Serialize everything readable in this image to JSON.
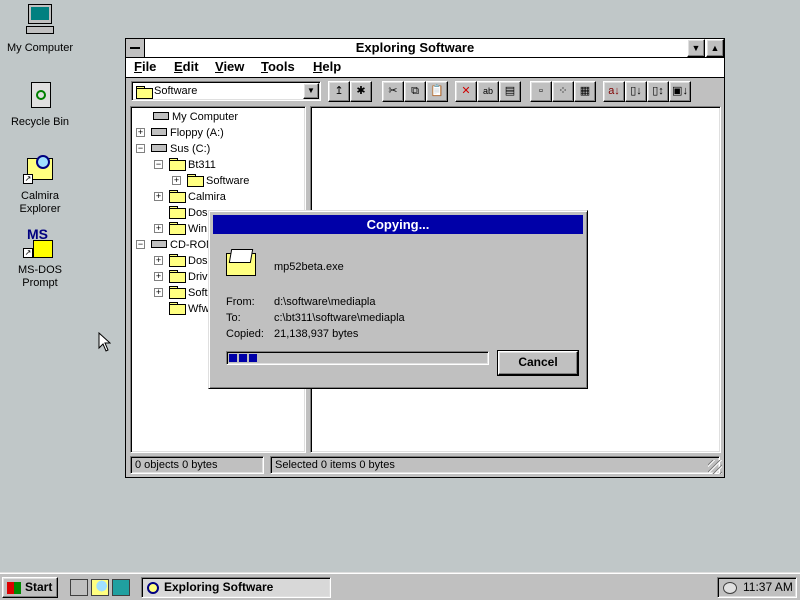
{
  "desktop": {
    "icons": [
      {
        "label": "My Computer",
        "icon": "computer-icon"
      },
      {
        "label": "Recycle Bin",
        "icon": "recycle-bin-icon"
      },
      {
        "label": "Calmira Explorer",
        "icon": "magnifier-icon"
      },
      {
        "label": "MS-DOS Prompt",
        "icon": "msdos-icon"
      }
    ]
  },
  "explorer": {
    "title": "Exploring Software",
    "menu": [
      "File",
      "Edit",
      "View",
      "Tools",
      "Help"
    ],
    "location": "Software",
    "tree": [
      {
        "label": "My Computer",
        "type": "computer"
      },
      {
        "label": "Floppy (A:)",
        "type": "drive"
      },
      {
        "label": "Sus (C:)",
        "type": "drive"
      },
      {
        "label": "Bt311",
        "type": "folder"
      },
      {
        "label": "Software",
        "type": "folder-open"
      },
      {
        "label": "Calmira",
        "type": "folder"
      },
      {
        "label": "Dos",
        "type": "folder"
      },
      {
        "label": "Win",
        "type": "folder"
      },
      {
        "label": "CD-ROM",
        "type": "cdrom"
      },
      {
        "label": "Dos",
        "type": "folder"
      },
      {
        "label": "Drive",
        "type": "folder"
      },
      {
        "label": "Soft",
        "type": "folder"
      },
      {
        "label": "Wfw",
        "type": "folder"
      }
    ],
    "status_left": "0 objects  0 bytes",
    "status_right": "Selected 0 items  0 bytes"
  },
  "dialog": {
    "title": "Copying...",
    "filename": "mp52beta.exe",
    "from_label": "From:",
    "from_value": "d:\\software\\mediapla",
    "to_label": "To:",
    "to_value": "c:\\bt311\\software\\mediapla",
    "copied_label": "Copied:",
    "copied_value": "21,138,937 bytes",
    "progress_percent": 12,
    "cancel_label": "Cancel"
  },
  "taskbar": {
    "start_label": "Start",
    "task_label": "Exploring Software",
    "clock": "11:37 AM"
  },
  "colors": {
    "desktop": "#c0c7c8",
    "title_active": "#0000a8",
    "face": "#c0c0c0"
  }
}
